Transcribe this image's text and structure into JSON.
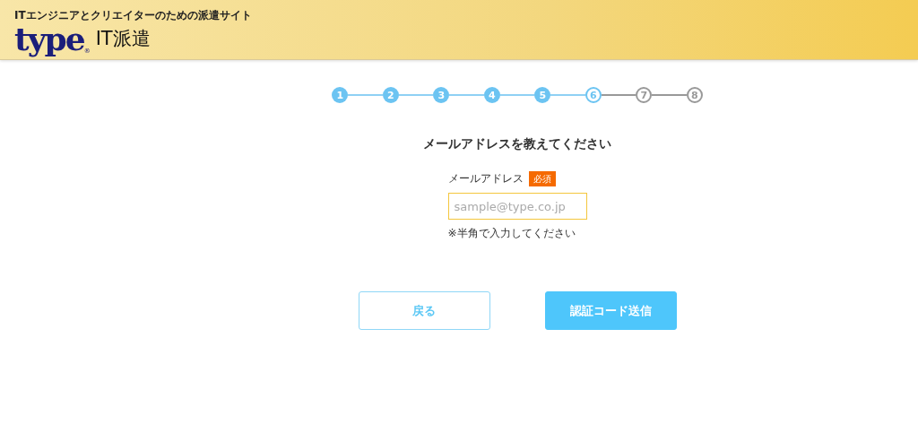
{
  "header": {
    "tagline": "ITエンジニアとクリエイターのための派遣サイト",
    "logo": "type",
    "registered_mark": "®",
    "service": "IT派遣"
  },
  "steps": [
    {
      "label": "1",
      "completed": true,
      "selected": false
    },
    {
      "label": "2",
      "completed": true,
      "selected": false
    },
    {
      "label": "3",
      "completed": true,
      "selected": false
    },
    {
      "label": "4",
      "completed": true,
      "selected": false
    },
    {
      "label": "5",
      "completed": true,
      "selected": false
    },
    {
      "label": "6",
      "completed": false,
      "selected": true
    },
    {
      "label": "7",
      "completed": false,
      "selected": false
    },
    {
      "label": "8",
      "completed": false,
      "selected": false
    }
  ],
  "title": "メールアドレスを教えてください",
  "field": {
    "label": "メールアドレス",
    "badge": "必須",
    "placeholder": "sample@type.co.jp",
    "note": "※半角で入力してください"
  },
  "buttons": [
    {
      "label": "戻る",
      "kind": "secondary"
    },
    {
      "label": "認証コード送信",
      "kind": "primary"
    }
  ]
}
